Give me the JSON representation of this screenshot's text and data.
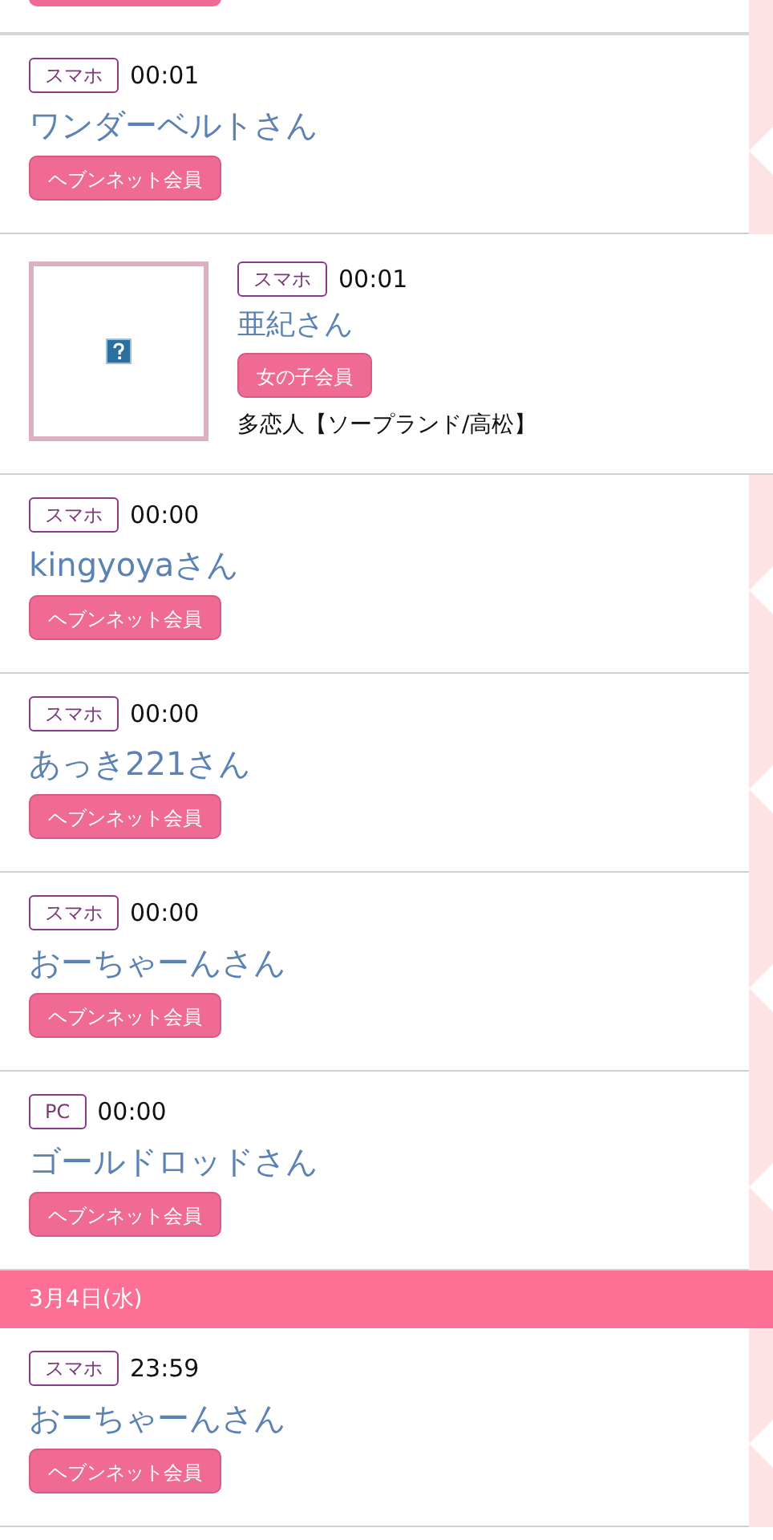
{
  "entries": [
    {
      "kind": "member",
      "device": "スマホ",
      "time": "00:01",
      "name": "ワンダーベルトさん",
      "badge": "ヘブンネット会員"
    },
    {
      "kind": "girl",
      "device": "スマホ",
      "time": "00:01",
      "name": "亜紀さん",
      "badge": "女の子会員",
      "shop": "多恋人【ソープランド/高松】"
    },
    {
      "kind": "member",
      "device": "スマホ",
      "time": "00:00",
      "name": "kingyoyaさん",
      "badge": "ヘブンネット会員"
    },
    {
      "kind": "member",
      "device": "スマホ",
      "time": "00:00",
      "name": "あっき221さん",
      "badge": "ヘブンネット会員"
    },
    {
      "kind": "member",
      "device": "スマホ",
      "time": "00:00",
      "name": "おーちゃーんさん",
      "badge": "ヘブンネット会員"
    },
    {
      "kind": "member",
      "device": "PC",
      "time": "00:00",
      "name": "ゴールドロッドさん",
      "badge": "ヘブンネット会員"
    },
    {
      "kind": "date",
      "label": "3月4日(水)"
    },
    {
      "kind": "member",
      "device": "スマホ",
      "time": "23:59",
      "name": "おーちゃーんさん",
      "badge": "ヘブンネット会員"
    }
  ]
}
